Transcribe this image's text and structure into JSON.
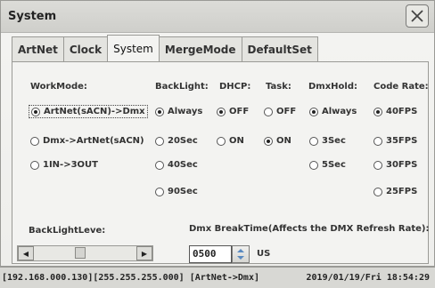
{
  "window": {
    "title": "System"
  },
  "tabs": [
    {
      "label": "ArtNet",
      "active": false
    },
    {
      "label": "Clock",
      "active": false
    },
    {
      "label": "System",
      "active": true
    },
    {
      "label": "MergeMode",
      "active": false
    },
    {
      "label": "DefaultSet",
      "active": false
    }
  ],
  "workmode": {
    "label": "WorkMode:",
    "options": [
      "ArtNet(sACN)->Dmx",
      "Dmx->ArtNet(sACN)",
      "1IN->3OUT"
    ],
    "selected": "ArtNet(sACN)->Dmx"
  },
  "backlight": {
    "label": "BackLight:",
    "options": [
      "Always",
      "20Sec",
      "40Sec",
      "90Sec"
    ],
    "selected": "Always"
  },
  "dhcp": {
    "label": "DHCP:",
    "options": [
      "OFF",
      "ON"
    ],
    "selected": "OFF"
  },
  "task": {
    "label": "Task:",
    "options": [
      "OFF",
      "ON"
    ],
    "selected": "ON"
  },
  "dmxhold": {
    "label": "DmxHold:",
    "options": [
      "Always",
      "3Sec",
      "5Sec"
    ],
    "selected": "Always"
  },
  "coderate": {
    "label": "Code Rate:",
    "options": [
      "40FPS",
      "35FPS",
      "30FPS",
      "25FPS"
    ],
    "selected": "40FPS"
  },
  "backlight_level": {
    "label": "BackLightLeve:",
    "level": 0.45
  },
  "dmx_breaktime": {
    "label": "Dmx BreakTime(Affects the DMX Refresh Rate):",
    "value": "0500",
    "unit": "US"
  },
  "status": {
    "left": "[192.168.000.130][255.255.255.000] [ArtNet->Dmx]",
    "right": "2019/01/19/Fri 18:54:29"
  },
  "colors": {
    "accent": "#5a8ac0",
    "background": "#f3f3f1"
  }
}
